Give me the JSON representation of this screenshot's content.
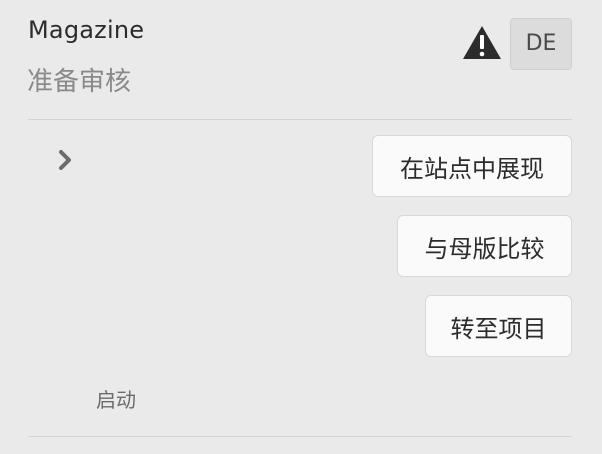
{
  "header": {
    "title": "Magazine",
    "subtitle": "准备审核",
    "warning_icon": "warning-triangle-icon",
    "language_badge": "DE"
  },
  "details": {
    "expand_icon": "chevron-right-icon",
    "launch_label": "启动"
  },
  "actions": {
    "view_on_site": "在站点中展现",
    "compare_master": "与母版比较",
    "go_to_project": "转至项目"
  },
  "colors": {
    "background": "#eaeaea",
    "button_bg": "#fafafa",
    "badge_bg": "#dcdcdc",
    "warning": "#2c2c2c"
  }
}
